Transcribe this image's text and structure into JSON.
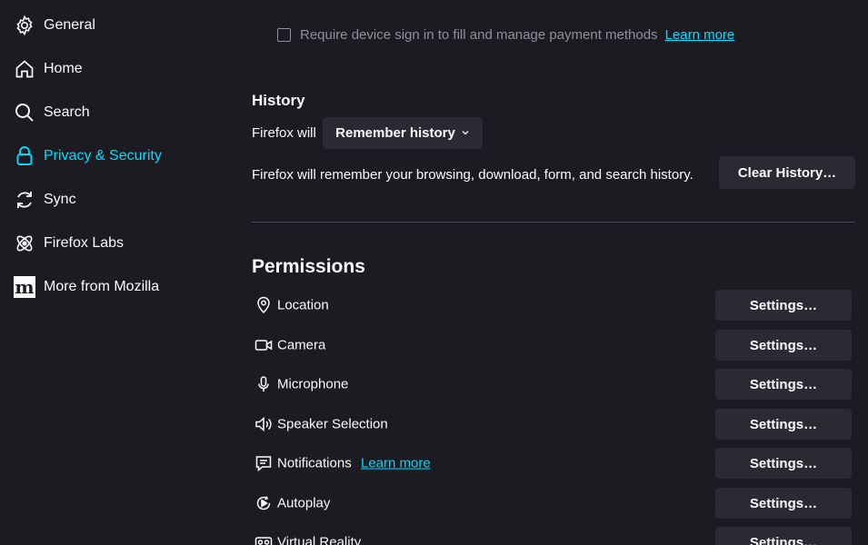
{
  "sidebar": {
    "items": [
      {
        "label": "General",
        "icon": "gear-icon"
      },
      {
        "label": "Home",
        "icon": "home-icon"
      },
      {
        "label": "Search",
        "icon": "search-icon"
      },
      {
        "label": "Privacy & Security",
        "icon": "lock-icon",
        "active": true
      },
      {
        "label": "Sync",
        "icon": "sync-icon"
      },
      {
        "label": "Firefox Labs",
        "icon": "labs-icon"
      },
      {
        "label": "More from Mozilla",
        "icon": "mozilla-icon"
      }
    ]
  },
  "payments": {
    "checkbox_label": "Require device sign in to fill and manage payment methods",
    "checked": false,
    "learn_more": "Learn more"
  },
  "history": {
    "title": "History",
    "firefox_will": "Firefox will",
    "dropdown_value": "Remember history",
    "description": "Firefox will remember your browsing, download, form, and search history.",
    "clear_button": "Clear History…"
  },
  "permissions": {
    "title": "Permissions",
    "items": [
      {
        "label": "Location",
        "icon": "location-icon",
        "button": "Settings…"
      },
      {
        "label": "Camera",
        "icon": "camera-icon",
        "button": "Settings…"
      },
      {
        "label": "Microphone",
        "icon": "microphone-icon",
        "button": "Settings…"
      },
      {
        "label": "Speaker Selection",
        "icon": "speaker-icon",
        "button": "Settings…"
      },
      {
        "label": "Notifications",
        "icon": "notification-icon",
        "button": "Settings…",
        "learn_more": "Learn more"
      },
      {
        "label": "Autoplay",
        "icon": "autoplay-icon",
        "button": "Settings…"
      },
      {
        "label": "Virtual Reality",
        "icon": "vr-icon",
        "button": "Settings…"
      }
    ]
  },
  "colors": {
    "background": "#1c1b22",
    "accent": "#00ddff",
    "button_bg": "#2b2a33",
    "muted_text": "#8f8f9d"
  }
}
